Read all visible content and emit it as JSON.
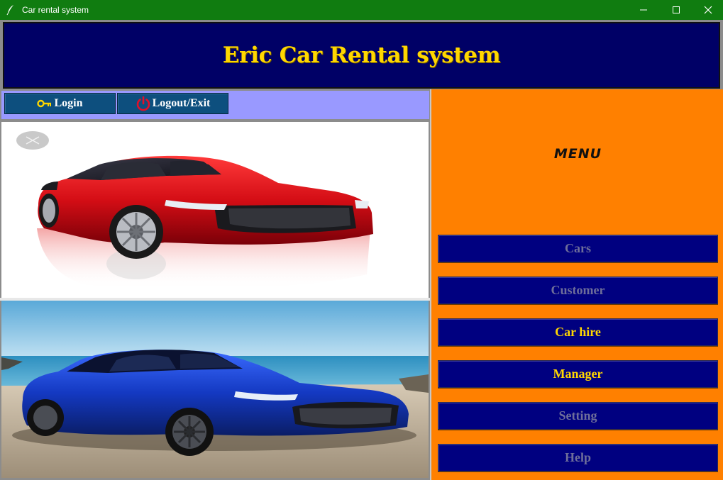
{
  "window": {
    "title": "Car rental system",
    "icon": "feather-icon",
    "controls": [
      "minimize-icon",
      "maximize-icon",
      "close-icon"
    ]
  },
  "header": {
    "title": "Eric Car Rental system"
  },
  "toolbar": {
    "login_label": "Login",
    "login_icon": "key-icon",
    "logout_label": "Logout/Exit",
    "logout_icon": "power-icon"
  },
  "menu": {
    "title": "MENU",
    "items": [
      {
        "label": "Cars",
        "state": "disabled"
      },
      {
        "label": "Customer",
        "state": "disabled"
      },
      {
        "label": "Car hire",
        "state": "enabled"
      },
      {
        "label": "Manager",
        "state": "enabled"
      },
      {
        "label": "Setting",
        "state": "disabled"
      },
      {
        "label": "Help",
        "state": "disabled"
      }
    ]
  },
  "colors": {
    "titlebar": "#107c10",
    "header_bg": "#000066",
    "header_text": "#ffd700",
    "toolbar_bg": "#9999ff",
    "toolbar_button": "#0d4f7e",
    "menu_bg": "#ff8000",
    "menu_button": "#000080",
    "menu_text_enabled": "#ffd700",
    "menu_text_disabled": "#6e6e9a"
  }
}
